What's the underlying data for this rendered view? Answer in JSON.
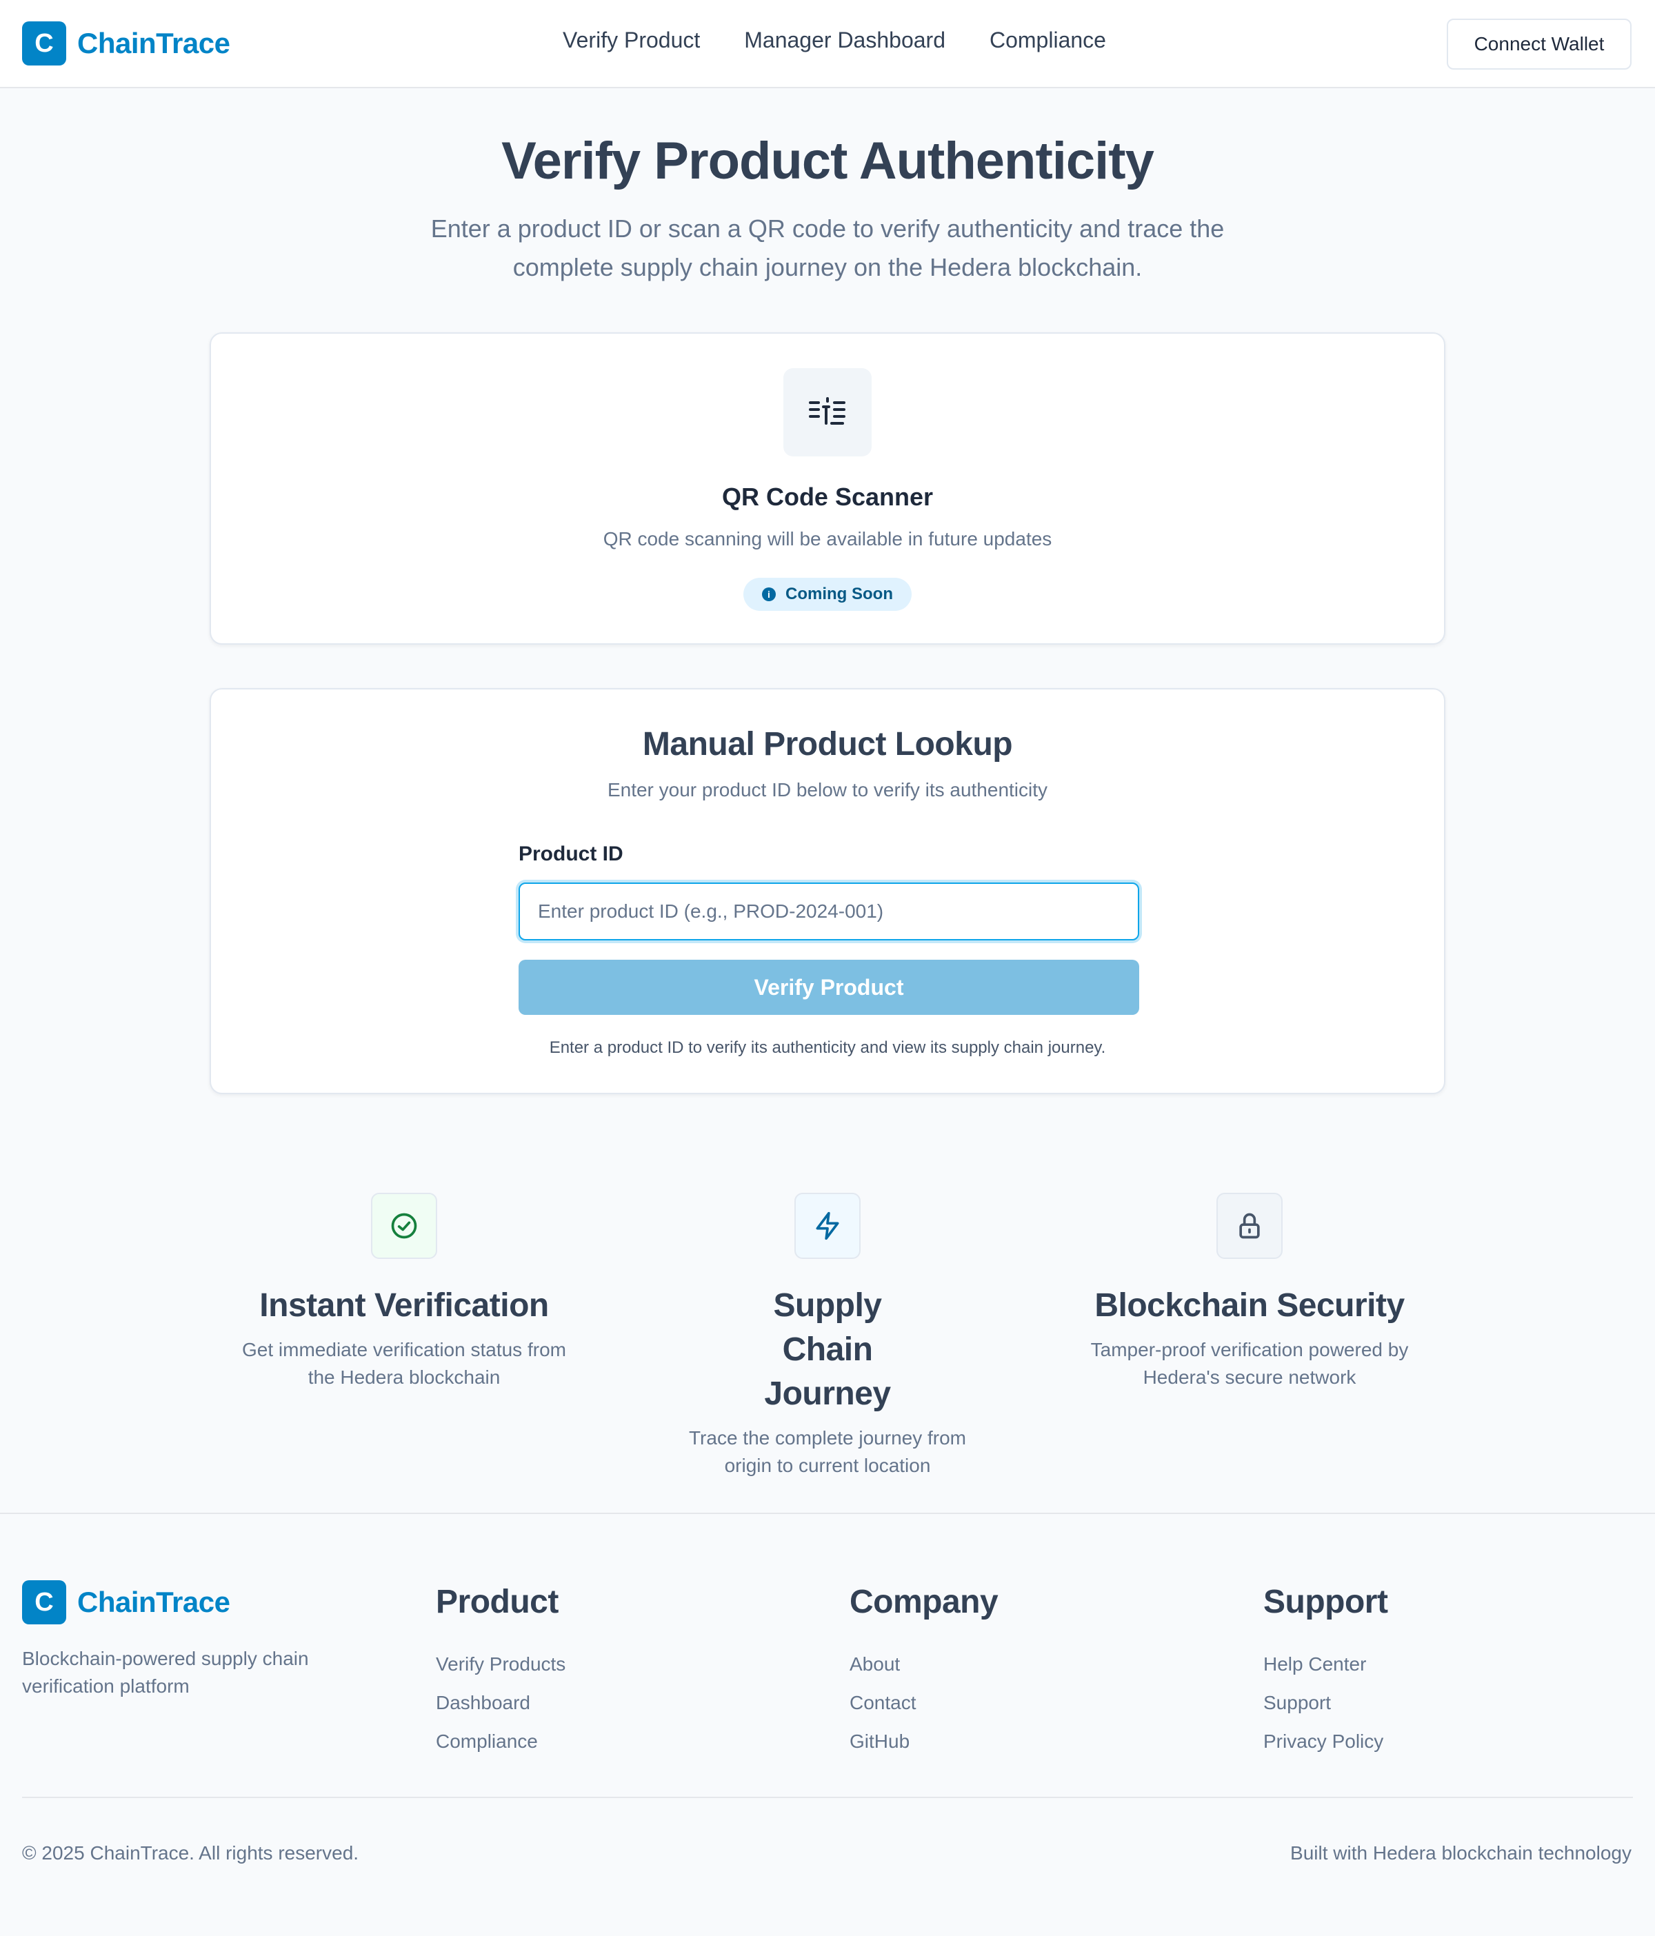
{
  "brand": {
    "logo_letter": "C",
    "name": "ChainTrace",
    "color": "#0284c7"
  },
  "nav": {
    "items": [
      {
        "label": "Verify Product"
      },
      {
        "label": "Manager Dashboard"
      },
      {
        "label": "Compliance"
      }
    ],
    "connect_wallet": "Connect Wallet"
  },
  "hero": {
    "title": "Verify Product Authenticity",
    "subtitle": "Enter a product ID or scan a QR code to verify authenticity and trace the complete supply chain journey on the Hedera blockchain."
  },
  "qr_card": {
    "icon": "qr-scanner-icon",
    "title": "QR Code Scanner",
    "description": "QR code scanning will be available in future updates",
    "badge": "Coming Soon",
    "badge_icon": "info-icon"
  },
  "lookup": {
    "title": "Manual Product Lookup",
    "description": "Enter your product ID below to verify its authenticity",
    "field_label": "Product ID",
    "input_value": "",
    "placeholder": "Enter product ID (e.g., PROD-2024-001)",
    "button_label": "Verify Product",
    "hint": "Enter a product ID to verify its authenticity and view its supply chain journey."
  },
  "features": [
    {
      "icon": "check-circle-icon",
      "title": "Instant Verification",
      "description": "Get immediate verification status from the Hedera blockchain",
      "accent": "#15803d"
    },
    {
      "icon": "lightning-icon",
      "title": "Supply Chain Journey",
      "description": "Trace the complete journey from origin to current location",
      "accent": "#0369a1"
    },
    {
      "icon": "lock-icon",
      "title": "Blockchain Security",
      "description": "Tamper-proof verification powered by Hedera's secure network",
      "accent": "#475569"
    }
  ],
  "footer": {
    "description": "Blockchain-powered supply chain verification platform",
    "columns": [
      {
        "title": "Product",
        "links": [
          "Verify Products",
          "Dashboard",
          "Compliance"
        ]
      },
      {
        "title": "Company",
        "links": [
          "About",
          "Contact",
          "GitHub"
        ]
      },
      {
        "title": "Support",
        "links": [
          "Help Center",
          "Support",
          "Privacy Policy"
        ]
      }
    ],
    "copyright": "© 2025 ChainTrace. All rights reserved.",
    "built_with": "Built with Hedera blockchain technology"
  }
}
